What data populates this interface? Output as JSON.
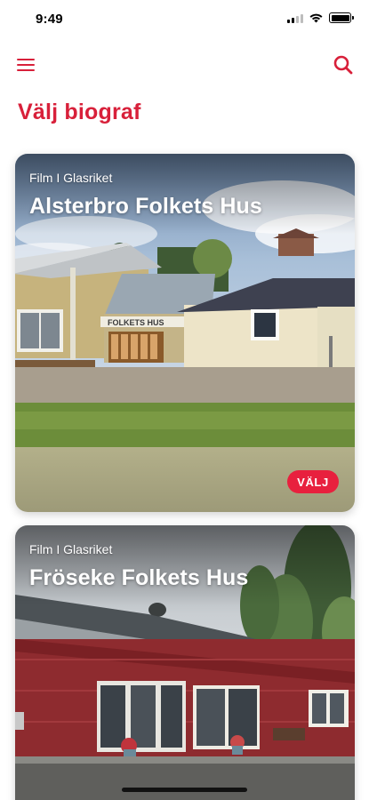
{
  "status_bar": {
    "time": "9:49"
  },
  "header": {
    "menu_icon": "hamburger-menu-icon",
    "search_icon": "search-icon"
  },
  "page": {
    "title": "Välj biograf"
  },
  "cinemas": [
    {
      "subtitle": "Film I Glasriket",
      "name": "Alsterbro Folkets Hus",
      "photo_sign": "FOLKETS HUS",
      "button_label": "VÄLJ"
    },
    {
      "subtitle": "Film I Glasriket",
      "name": "Fröseke Folkets Hus"
    }
  ],
  "colors": {
    "accent": "#d8203a",
    "button": "#e8203e"
  }
}
